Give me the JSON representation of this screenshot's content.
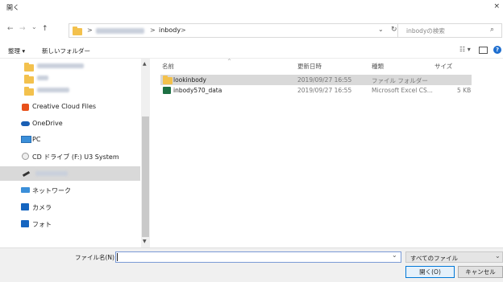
{
  "title": "開く",
  "window": {
    "close_glyph": "×"
  },
  "nav": {
    "back": "←",
    "forward": "→",
    "dropdown": "⌄",
    "up": "↑",
    "breadcrumb": [
      ">",
      "inbody",
      ">"
    ],
    "address_dropdown": "⌄",
    "refresh": "↻",
    "search_placeholder": "inbodyの検索",
    "search_glyph": "⌕"
  },
  "toolbar": {
    "organize": "整理 ▾",
    "new_folder": "新しいフォルダー",
    "view_glyph": "☷ ▾"
  },
  "sidebar": {
    "items": [
      {
        "label": "Creative Cloud Files"
      },
      {
        "label": "OneDrive"
      },
      {
        "label": "PC"
      },
      {
        "label": "CD ドライブ (F:) U3 System"
      },
      {
        "label": "ネットワーク"
      },
      {
        "label": "カメラ"
      },
      {
        "label": "フォト"
      }
    ]
  },
  "columns": {
    "name": "名前",
    "date": "更新日時",
    "type": "種類",
    "size": "サイズ"
  },
  "files": [
    {
      "name": "lookinbody",
      "date": "2019/09/27 16:55",
      "type": "ファイル フォルダー",
      "size": ""
    },
    {
      "name": "inbody570_data",
      "date": "2019/09/27 16:55",
      "type": "Microsoft Excel CS...",
      "size": "5 KB"
    }
  ],
  "bottom": {
    "filename_label": "ファイル名(N):",
    "filename_value": "",
    "filetype": "すべてのファイル",
    "open": "開く(O)",
    "cancel": "キャンセル"
  },
  "colors": {
    "accent": "#0078d7",
    "folder": "#f3c14d",
    "selection": "#d9d9d9"
  }
}
